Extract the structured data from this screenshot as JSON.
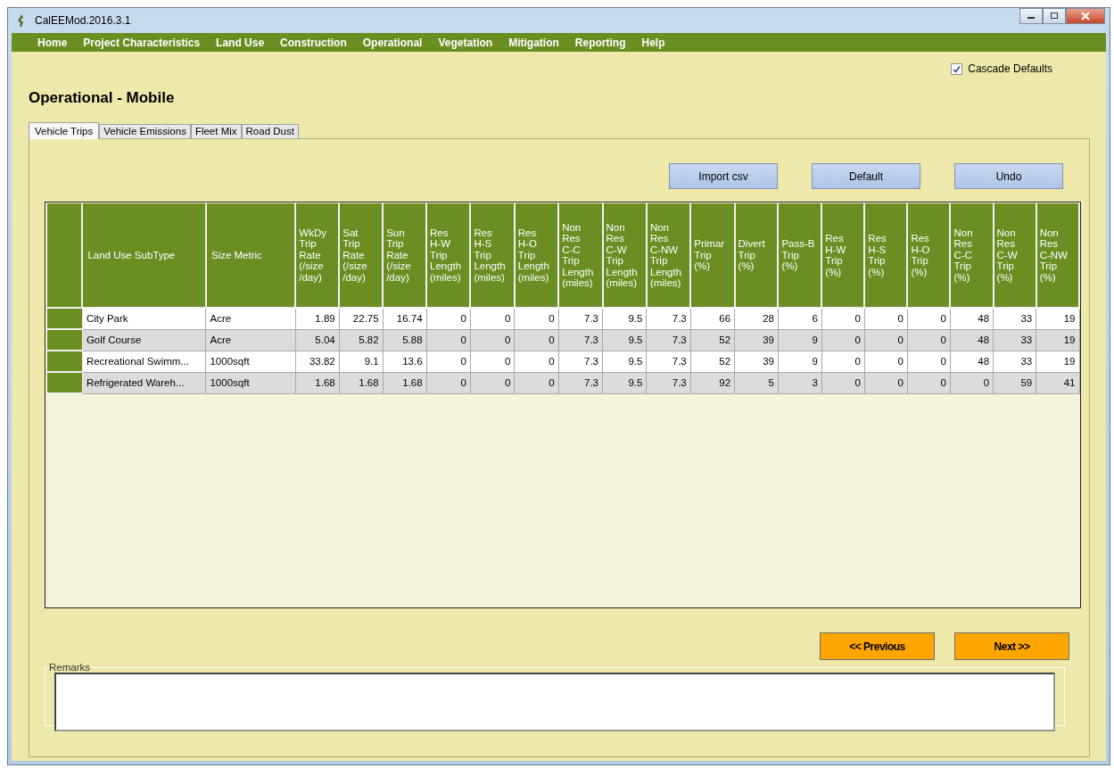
{
  "window": {
    "title": "CalEEMod.2016.3.1"
  },
  "menu": [
    "Home",
    "Project Characteristics",
    "Land Use",
    "Construction",
    "Operational",
    "Vegetation",
    "Mitigation",
    "Reporting",
    "Help"
  ],
  "cascade_defaults": {
    "label": "Cascade Defaults",
    "checked": true
  },
  "page_title": "Operational - Mobile",
  "tabs": [
    {
      "label": "Vehicle Trips",
      "selected": true
    },
    {
      "label": "Vehicle Emissions",
      "selected": false
    },
    {
      "label": "Fleet Mix",
      "selected": false
    },
    {
      "label": "Road Dust",
      "selected": false
    }
  ],
  "actions": [
    "Import csv",
    "Default",
    "Undo"
  ],
  "table": {
    "columns": [
      "Land Use SubType",
      "Size Metric",
      "WkDy\nTrip\nRate\n(/size\n/day)",
      "Sat\nTrip\nRate\n(/size\n/day)",
      "Sun\nTrip\nRate\n(/size\n/day)",
      "Res\nH-W\nTrip\nLength\n(miles)",
      "Res\nH-S\nTrip\nLength\n(miles)",
      "Res\nH-O\nTrip\nLength\n(miles)",
      "Non\nRes\nC-C\nTrip\nLength\n(miles)",
      "Non\nRes\nC-W\nTrip\nLength\n(miles)",
      "Non\nRes\nC-NW\nTrip\nLength\n(miles)",
      "Primar\nTrip\n(%)",
      "Divert\nTrip\n(%)",
      "Pass-B\nTrip\n(%)",
      "Res\nH-W\nTrip\n(%)",
      "Res\nH-S\nTrip\n(%)",
      "Res\nH-O\nTrip\n(%)",
      "Non\nRes\nC-C\nTrip\n(%)",
      "Non\nRes\nC-W\nTrip\n(%)",
      "Non\nRes\nC-NW\nTrip\n(%)"
    ],
    "rows": [
      [
        "City Park",
        "Acre",
        "1.89",
        "22.75",
        "16.74",
        "0",
        "0",
        "0",
        "7.3",
        "9.5",
        "7.3",
        "66",
        "28",
        "6",
        "0",
        "0",
        "0",
        "48",
        "33",
        "19"
      ],
      [
        "Golf Course",
        "Acre",
        "5.04",
        "5.82",
        "5.88",
        "0",
        "0",
        "0",
        "7.3",
        "9.5",
        "7.3",
        "52",
        "39",
        "9",
        "0",
        "0",
        "0",
        "48",
        "33",
        "19"
      ],
      [
        "Recreational Swimm...",
        "1000sqft",
        "33.82",
        "9.1",
        "13.6",
        "0",
        "0",
        "0",
        "7.3",
        "9.5",
        "7.3",
        "52",
        "39",
        "9",
        "0",
        "0",
        "0",
        "48",
        "33",
        "19"
      ],
      [
        "Refrigerated Wareh...",
        "1000sqft",
        "1.68",
        "1.68",
        "1.68",
        "0",
        "0",
        "0",
        "7.3",
        "9.5",
        "7.3",
        "92",
        "5",
        "3",
        "0",
        "0",
        "0",
        "0",
        "59",
        "41"
      ]
    ]
  },
  "navigation": {
    "previous": "<< Previous",
    "next": "Next >>"
  },
  "remarks": {
    "label": "Remarks"
  }
}
